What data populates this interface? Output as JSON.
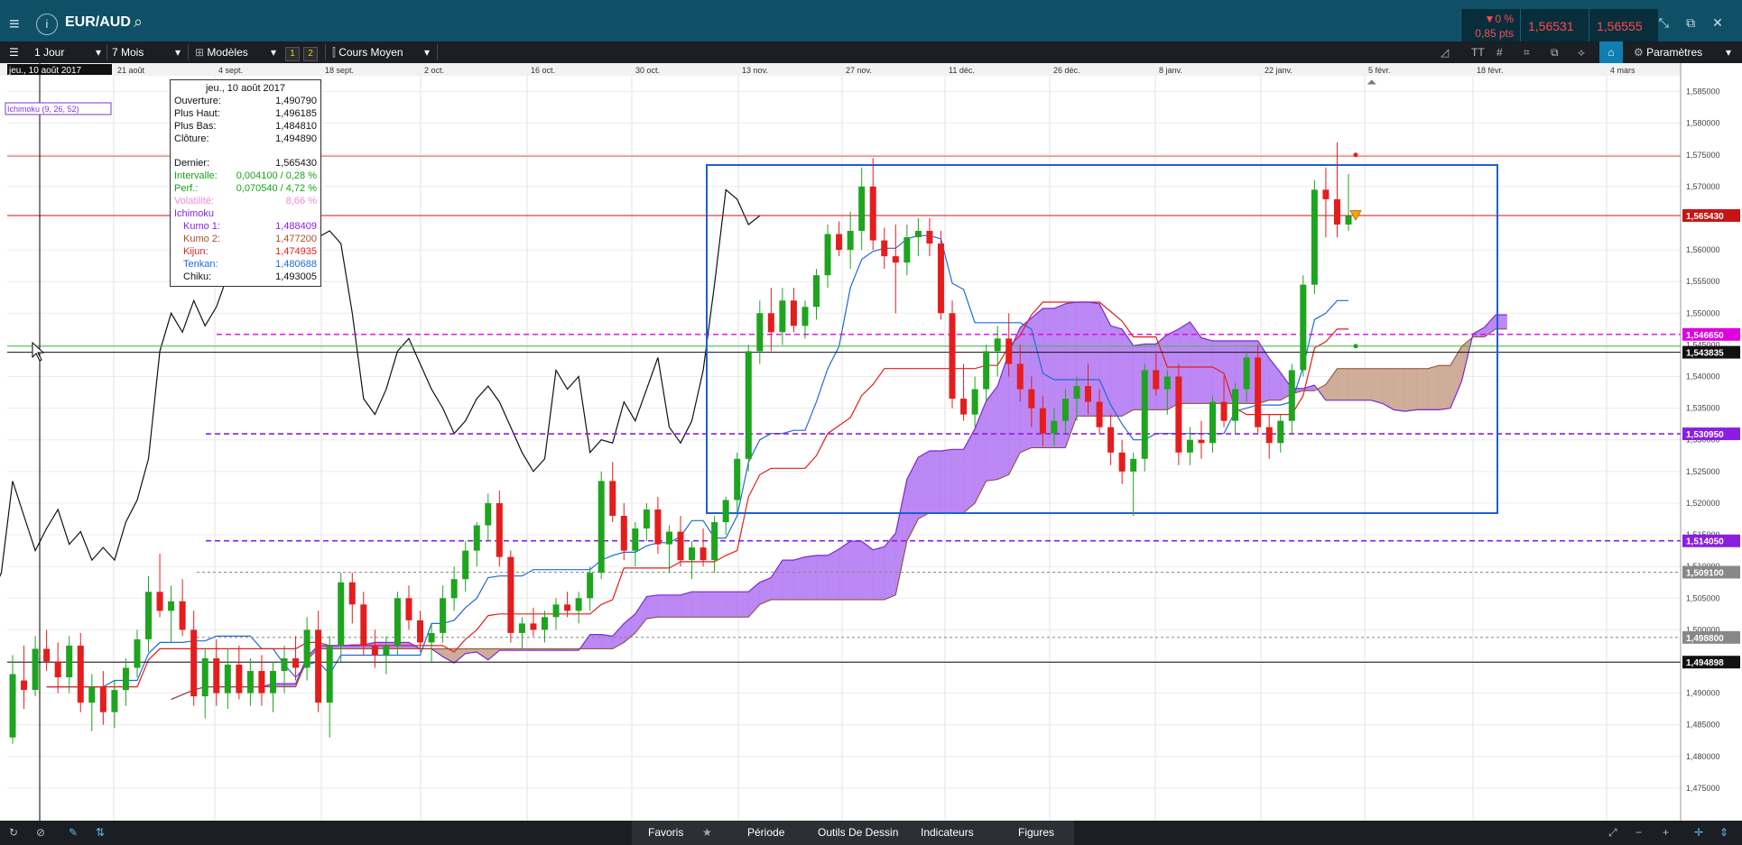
{
  "top": {
    "symbol": "EUR/AUD",
    "change_pct": "▼0 %",
    "change_pts": "0,85 pts",
    "bid": "1,56531",
    "ask": "1,56555"
  },
  "toolbar": {
    "period": "1 Jour",
    "range": "7 Mois",
    "models": "Modèles",
    "badge1": "1",
    "badge2": "2",
    "price_type": "Cours Moyen",
    "settings": "Paramètres"
  },
  "bottom": {
    "favoris": "Favoris",
    "periode": "Période",
    "outils": "Outils De Dessin",
    "indicateurs": "Indicateurs",
    "figures": "Figures"
  },
  "indicator_tag": "Ichimoku (9, 26, 52)",
  "hover_date_tag": "jeu., 10 août 2017",
  "info": {
    "date": "jeu., 10 août 2017",
    "ouverture_k": "Ouverture:",
    "ouverture_v": "1,490790",
    "haut_k": "Plus Haut:",
    "haut_v": "1,496185",
    "bas_k": "Plus Bas:",
    "bas_v": "1,484810",
    "cloture_k": "Clôture:",
    "cloture_v": "1,494890",
    "dernier_k": "Dernier:",
    "dernier_v": "1,565430",
    "intervalle_k": "Intervalle:",
    "intervalle_v": "0,004100 / 0,28 %",
    "perf_k": "Perf.:",
    "perf_v": "0,070540 / 4,72 %",
    "vol_k": "Volatilité:",
    "vol_v": "8,66 %",
    "ichimoku": "Ichimoku",
    "kumo1_k": "Kumo 1:",
    "kumo1_v": "1,488409",
    "kumo2_k": "Kumo 2:",
    "kumo2_v": "1,477200",
    "kijun_k": "Kijun:",
    "kijun_v": "1,474935",
    "tenkan_k": "Tenkan:",
    "tenkan_v": "1,480688",
    "chiku_k": "Chiku:",
    "chiku_v": "1,493005"
  },
  "chart_data": {
    "type": "candlestick",
    "x_labels": [
      "21 août",
      "4 sept.",
      "18 sept.",
      "2 oct.",
      "16 oct.",
      "30 oct.",
      "13 nov.",
      "27 nov.",
      "11 déc.",
      "26 déc.",
      "8 janv.",
      "22 janv.",
      "5 févr.",
      "18 févr.",
      "4 mars"
    ],
    "y_ticks": [
      "1,585000",
      "1,580000",
      "1,575000",
      "1,570000",
      "1,565000",
      "1,560000",
      "1,555000",
      "1,550000",
      "1,545000",
      "1,540000",
      "1,535000",
      "1,530000",
      "1,525000",
      "1,520000",
      "1,515000",
      "1,510000",
      "1,505000",
      "1,500000",
      "1,495000",
      "1,490000",
      "1,485000",
      "1,480000",
      "1,475000"
    ],
    "ylim": [
      1.471,
      1.5875
    ],
    "price_tags": [
      {
        "price": 1.56543,
        "label": "1,565430",
        "color": "#c81414"
      },
      {
        "price": 1.543835,
        "label": "1,543835",
        "color": "#111111"
      },
      {
        "price": 1.54665,
        "label": "1,546650",
        "color": "#e000e0"
      },
      {
        "price": 1.53095,
        "label": "1,530950",
        "color": "#8a1ee0"
      },
      {
        "price": 1.51405,
        "label": "1,514050",
        "color": "#8a1ee0"
      },
      {
        "price": 1.5091,
        "label": "1,509100",
        "color": "#888888"
      },
      {
        "price": 1.4988,
        "label": "1,498800",
        "color": "#888888"
      },
      {
        "price": 1.494898,
        "label": "1,494898",
        "color": "#111111"
      }
    ],
    "candles": [
      [
        1.483,
        1.496,
        1.482,
        1.493
      ],
      [
        1.492,
        1.4975,
        1.4875,
        1.4905
      ],
      [
        1.4905,
        1.499,
        1.4895,
        1.497
      ],
      [
        1.497,
        1.5,
        1.4935,
        1.495
      ],
      [
        1.495,
        1.498,
        1.49,
        1.4925
      ],
      [
        1.4925,
        1.499,
        1.49,
        1.4975
      ],
      [
        1.4975,
        1.4995,
        1.487,
        1.4885
      ],
      [
        1.4885,
        1.493,
        1.484,
        1.491
      ],
      [
        1.491,
        1.4935,
        1.485,
        1.487
      ],
      [
        1.487,
        1.492,
        1.4845,
        1.4905
      ],
      [
        1.4905,
        1.4955,
        1.488,
        1.494
      ],
      [
        1.494,
        1.5,
        1.4925,
        1.4985
      ],
      [
        1.4985,
        1.5085,
        1.4965,
        1.506
      ],
      [
        1.506,
        1.512,
        1.502,
        1.503
      ],
      [
        1.503,
        1.507,
        1.498,
        1.5045
      ],
      [
        1.5045,
        1.508,
        1.499,
        1.5
      ],
      [
        1.5,
        1.503,
        1.488,
        1.4895
      ],
      [
        1.4895,
        1.497,
        1.486,
        1.4955
      ],
      [
        1.4955,
        1.4985,
        1.488,
        1.49
      ],
      [
        1.49,
        1.497,
        1.4875,
        1.4945
      ],
      [
        1.4945,
        1.4975,
        1.489,
        1.49
      ],
      [
        1.49,
        1.4955,
        1.488,
        1.4935
      ],
      [
        1.4935,
        1.496,
        1.488,
        1.49
      ],
      [
        1.49,
        1.495,
        1.487,
        1.4935
      ],
      [
        1.4935,
        1.4975,
        1.49,
        1.4955
      ],
      [
        1.4955,
        1.499,
        1.492,
        1.494
      ],
      [
        1.494,
        1.502,
        1.492,
        1.5
      ],
      [
        1.5,
        1.503,
        1.487,
        1.4885
      ],
      [
        1.4885,
        1.499,
        1.483,
        1.4975
      ],
      [
        1.4975,
        1.509,
        1.495,
        1.5075
      ],
      [
        1.5075,
        1.509,
        1.501,
        1.504
      ],
      [
        1.504,
        1.506,
        1.496,
        1.4975
      ],
      [
        1.4975,
        1.5,
        1.494,
        1.496
      ],
      [
        1.496,
        1.499,
        1.493,
        1.4975
      ],
      [
        1.4975,
        1.506,
        1.496,
        1.505
      ],
      [
        1.505,
        1.507,
        1.5,
        1.5015
      ],
      [
        1.5015,
        1.503,
        1.4965,
        1.498
      ],
      [
        1.498,
        1.501,
        1.495,
        1.4995
      ],
      [
        1.4995,
        1.507,
        1.498,
        1.505
      ],
      [
        1.505,
        1.51,
        1.503,
        1.508
      ],
      [
        1.508,
        1.514,
        1.506,
        1.5125
      ],
      [
        1.5125,
        1.517,
        1.51,
        1.5165
      ],
      [
        1.5165,
        1.5215,
        1.514,
        1.52
      ],
      [
        1.52,
        1.522,
        1.51,
        1.5115
      ],
      [
        1.5115,
        1.5125,
        1.498,
        1.4995
      ],
      [
        1.4995,
        1.502,
        1.497,
        1.501
      ],
      [
        1.501,
        1.5035,
        1.499,
        1.5
      ],
      [
        1.5,
        1.503,
        1.498,
        1.502
      ],
      [
        1.502,
        1.505,
        1.5,
        1.504
      ],
      [
        1.504,
        1.506,
        1.502,
        1.503
      ],
      [
        1.503,
        1.506,
        1.501,
        1.505
      ],
      [
        1.505,
        1.51,
        1.503,
        1.509
      ],
      [
        1.509,
        1.525,
        1.508,
        1.5235
      ],
      [
        1.5235,
        1.5265,
        1.517,
        1.518
      ],
      [
        1.518,
        1.52,
        1.511,
        1.5125
      ],
      [
        1.5125,
        1.517,
        1.51,
        1.516
      ],
      [
        1.516,
        1.52,
        1.514,
        1.519
      ],
      [
        1.519,
        1.521,
        1.512,
        1.5135
      ],
      [
        1.5135,
        1.5165,
        1.509,
        1.5155
      ],
      [
        1.5155,
        1.518,
        1.51,
        1.511
      ],
      [
        1.511,
        1.514,
        1.508,
        1.513
      ],
      [
        1.513,
        1.516,
        1.51,
        1.511
      ],
      [
        1.511,
        1.518,
        1.509,
        1.517
      ],
      [
        1.517,
        1.521,
        1.515,
        1.5205
      ],
      [
        1.5205,
        1.528,
        1.5185,
        1.527
      ],
      [
        1.527,
        1.545,
        1.525,
        1.544
      ],
      [
        1.544,
        1.552,
        1.542,
        1.55
      ],
      [
        1.55,
        1.554,
        1.544,
        1.547
      ],
      [
        1.547,
        1.554,
        1.545,
        1.552
      ],
      [
        1.552,
        1.554,
        1.547,
        1.548
      ],
      [
        1.548,
        1.552,
        1.546,
        1.551
      ],
      [
        1.551,
        1.557,
        1.549,
        1.556
      ],
      [
        1.556,
        1.564,
        1.554,
        1.5625
      ],
      [
        1.5625,
        1.5645,
        1.559,
        1.56
      ],
      [
        1.56,
        1.566,
        1.557,
        1.563
      ],
      [
        1.563,
        1.573,
        1.56,
        1.57
      ],
      [
        1.57,
        1.5745,
        1.56,
        1.5615
      ],
      [
        1.5615,
        1.5635,
        1.557,
        1.559
      ],
      [
        1.559,
        1.564,
        1.55,
        1.558
      ],
      [
        1.558,
        1.564,
        1.556,
        1.562
      ],
      [
        1.562,
        1.565,
        1.559,
        1.563
      ],
      [
        1.563,
        1.565,
        1.559,
        1.561
      ],
      [
        1.561,
        1.563,
        1.549,
        1.55
      ],
      [
        1.55,
        1.552,
        1.535,
        1.5365
      ],
      [
        1.5365,
        1.542,
        1.533,
        1.534
      ],
      [
        1.534,
        1.54,
        1.532,
        1.538
      ],
      [
        1.538,
        1.545,
        1.536,
        1.544
      ],
      [
        1.544,
        1.548,
        1.54,
        1.546
      ],
      [
        1.546,
        1.55,
        1.54,
        1.542
      ],
      [
        1.542,
        1.545,
        1.536,
        1.538
      ],
      [
        1.538,
        1.54,
        1.532,
        1.535
      ],
      [
        1.535,
        1.537,
        1.529,
        1.531
      ],
      [
        1.531,
        1.535,
        1.529,
        1.533
      ],
      [
        1.533,
        1.538,
        1.531,
        1.5365
      ],
      [
        1.5365,
        1.54,
        1.533,
        1.5385
      ],
      [
        1.5385,
        1.542,
        1.534,
        1.536
      ],
      [
        1.536,
        1.538,
        1.531,
        1.532
      ],
      [
        1.532,
        1.534,
        1.526,
        1.528
      ],
      [
        1.528,
        1.53,
        1.523,
        1.525
      ],
      [
        1.525,
        1.528,
        1.518,
        1.527
      ],
      [
        1.527,
        1.542,
        1.525,
        1.541
      ],
      [
        1.541,
        1.544,
        1.537,
        1.538
      ],
      [
        1.538,
        1.541,
        1.534,
        1.54
      ],
      [
        1.54,
        1.542,
        1.526,
        1.528
      ],
      [
        1.528,
        1.532,
        1.526,
        1.53
      ],
      [
        1.53,
        1.533,
        1.527,
        1.5295
      ],
      [
        1.5295,
        1.537,
        1.528,
        1.536
      ],
      [
        1.536,
        1.54,
        1.532,
        1.533
      ],
      [
        1.533,
        1.539,
        1.531,
        1.538
      ],
      [
        1.538,
        1.544,
        1.536,
        1.543
      ],
      [
        1.543,
        1.545,
        1.531,
        1.532
      ],
      [
        1.532,
        1.534,
        1.527,
        1.5295
      ],
      [
        1.5295,
        1.534,
        1.528,
        1.533
      ],
      [
        1.533,
        1.542,
        1.531,
        1.541
      ],
      [
        1.541,
        1.556,
        1.54,
        1.5545
      ],
      [
        1.5545,
        1.571,
        1.553,
        1.5695
      ],
      [
        1.5695,
        1.573,
        1.562,
        1.568
      ],
      [
        1.568,
        1.577,
        1.562,
        1.564
      ],
      [
        1.564,
        1.572,
        1.563,
        1.5654
      ]
    ]
  }
}
